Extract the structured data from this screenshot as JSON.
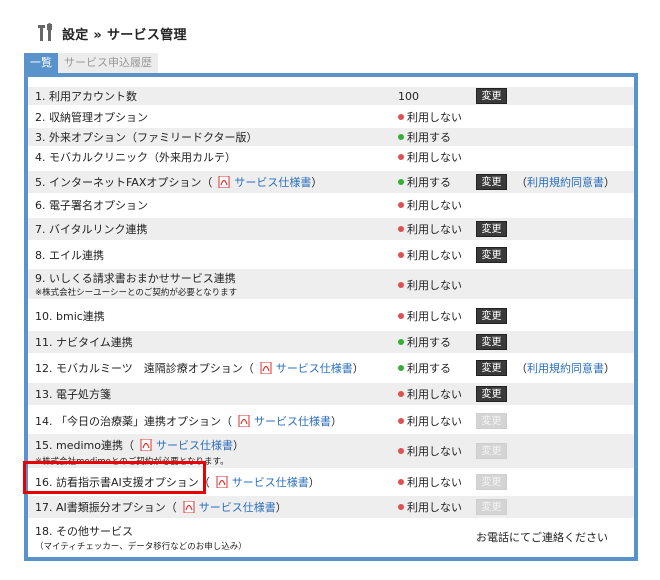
{
  "header": {
    "title": "設定 » サービス管理"
  },
  "tabs": [
    {
      "label": "一覧",
      "active": true
    },
    {
      "label": "サービス申込履歴",
      "active": false
    }
  ],
  "services": [
    {
      "label": "1. 利用アカウント数",
      "status": "100"
    },
    {
      "label": "2. 収納管理オプション",
      "status": "利用しない"
    },
    {
      "label": "3. 外来オプション（ファミリードクター版）",
      "status": "利用する"
    },
    {
      "label": "4. モバカルクリニック（外来用カルテ）",
      "status": "利用しない"
    },
    {
      "label": "5. インターネットFAXオプション（",
      "status": "利用する",
      "spec_link": "サービス仕様書",
      "after_spec": "）",
      "extra": "利用規約同意書"
    },
    {
      "label": "6. 電子署名オプション",
      "status": "利用しない"
    },
    {
      "label": "7. バイタルリンク連携",
      "status": "利用しない"
    },
    {
      "label": "8. エイル連携",
      "status": "利用しない"
    },
    {
      "label": "9. いしくる請求書おまかせサービス連携",
      "sub": "※株式会社シーユーシーとのご契約が必要となります",
      "status": "利用しない"
    },
    {
      "label": "10. bmic連携",
      "status": "利用しない"
    },
    {
      "label": "11. ナビタイム連携",
      "status": "利用する"
    },
    {
      "label": "12. モバカルミーツ　遠隔診療オプション（",
      "status": "利用する",
      "spec_link": "サービス仕様書",
      "after_spec": "）",
      "extra": "利用規約同意書"
    },
    {
      "label": "13. 電子処方箋",
      "status": "利用しない"
    },
    {
      "label": "14. 「今日の治療薬」連携オプション（",
      "status": "利用しない",
      "spec_link": "サービス仕様書",
      "after_spec": "）"
    },
    {
      "label": "15. medimo連携（",
      "sub": "※株式会社medimoとのご契約が必要となります。",
      "status": "利用しない",
      "spec_link": "サービス仕様書",
      "after_spec": "）"
    },
    {
      "label": "16. 訪看指示書AI支援オプション（",
      "status": "利用しない",
      "spec_link": "サービス仕様書",
      "after_spec": "）"
    },
    {
      "label": "17. AI書類振分オプション（",
      "status": "利用しない",
      "spec_link": "サービス仕様書",
      "after_spec": "）"
    },
    {
      "label": "18. その他サービス",
      "sub": "（マイティチェッカー、データ移行などのお申し込み）",
      "contact": "お電話にてご連絡ください"
    }
  ],
  "ui": {
    "change_label": "変更",
    "extra_open": "（",
    "extra_close": "）"
  },
  "colors": {
    "accent": "#5a93cc",
    "status_off": "#e05050",
    "status_on": "#33b033",
    "link": "#2a6fbd",
    "highlight": "#e60000"
  },
  "icons": {
    "header": "tools-icon",
    "spec_link": "pdf-icon",
    "status": "status-dot-icon"
  }
}
